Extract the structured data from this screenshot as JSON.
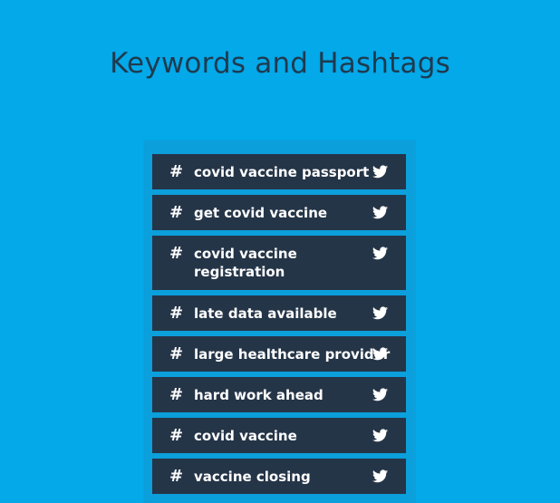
{
  "header": {
    "title": "Keywords and Hashtags"
  },
  "colors": {
    "background": "#03a9e9",
    "panel": "#0b9fdc",
    "item_background": "#253548",
    "title_color": "#1f3a4f",
    "item_text": "#ffffff"
  },
  "keywords": {
    "items": [
      {
        "symbol": "#",
        "label": "covid vaccine passport",
        "icon": "twitter-icon"
      },
      {
        "symbol": "#",
        "label": "get covid vaccine",
        "icon": "twitter-icon"
      },
      {
        "symbol": "#",
        "label": "covid vaccine registration",
        "icon": "twitter-icon"
      },
      {
        "symbol": "#",
        "label": "late data available",
        "icon": "twitter-icon"
      },
      {
        "symbol": "#",
        "label": "large healthcare provider",
        "icon": "twitter-icon"
      },
      {
        "symbol": "#",
        "label": "hard work ahead",
        "icon": "twitter-icon"
      },
      {
        "symbol": "#",
        "label": "covid vaccine",
        "icon": "twitter-icon"
      },
      {
        "symbol": "#",
        "label": "vaccine closing",
        "icon": "twitter-icon"
      }
    ]
  }
}
